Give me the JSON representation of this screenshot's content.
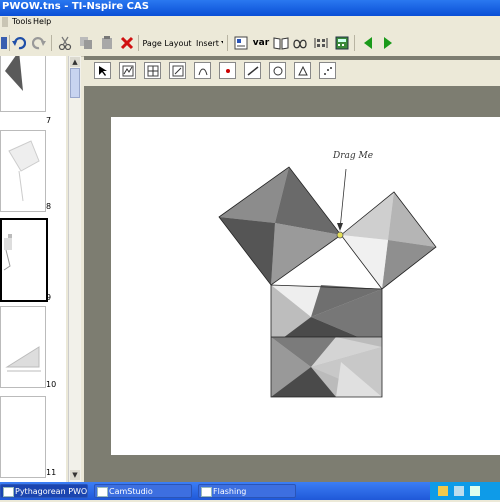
{
  "window": {
    "title": "PWOW.tns - TI-Nspire CAS"
  },
  "menu": {
    "items": [
      "Tools",
      "Help"
    ]
  },
  "toolbar": {
    "page_layout_label": "Page Layout",
    "insert_label": "Insert",
    "var_label": "var"
  },
  "thumbnails": [
    {
      "page": "7"
    },
    {
      "page": "8"
    },
    {
      "page": "9",
      "selected": true
    },
    {
      "page": "10"
    },
    {
      "page": "11"
    }
  ],
  "canvas": {
    "annotation": "Drag Me"
  },
  "taskbar": {
    "items": [
      {
        "label": "Pythagorean PWOW..."
      },
      {
        "label": "CamStudio"
      },
      {
        "label": "Flashing"
      }
    ]
  },
  "colors": {
    "titlebar": "#0a4fd6",
    "workarea": "#7d7d71",
    "nav_green": "#1a9a1a",
    "delete_red": "#d01010"
  }
}
